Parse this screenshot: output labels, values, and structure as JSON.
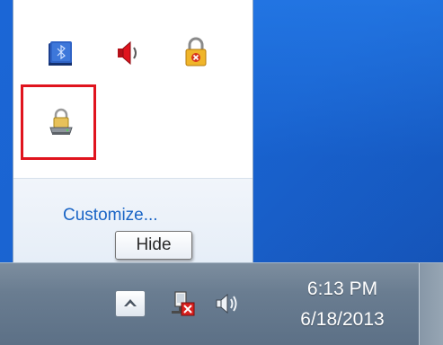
{
  "popup": {
    "icons": [
      {
        "name": "bluetooth-icon"
      },
      {
        "name": "speaker-icon",
        "color": "#e0141e"
      },
      {
        "name": "lock-icon",
        "color": "#e8a21c"
      },
      {
        "name": "drive-lock-icon"
      }
    ],
    "customize_link": "Customize..."
  },
  "tooltip": {
    "text": "Hide"
  },
  "taskbar": {
    "show_hidden_icons": {
      "icon": "chevron-up-icon"
    },
    "network_icon": "network-icon",
    "volume_icon": "volume-icon",
    "clock": {
      "time": "6:13 PM",
      "date": "6/18/2013"
    }
  },
  "colors": {
    "highlight": "#e0141e",
    "desktop": "#1b66d6",
    "link": "#1a65c6"
  }
}
